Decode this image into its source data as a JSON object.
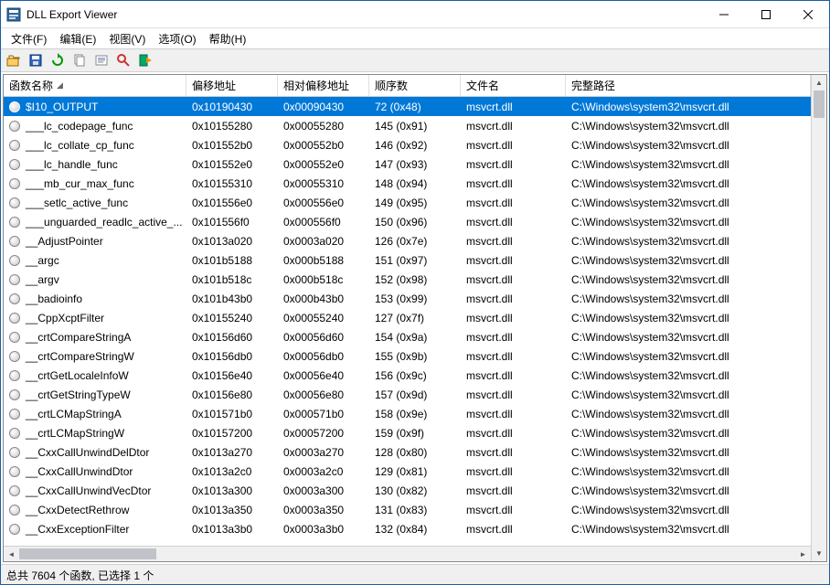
{
  "window": {
    "title": "DLL Export Viewer"
  },
  "menubar": {
    "items": [
      {
        "label": "文件(F)"
      },
      {
        "label": "编辑(E)"
      },
      {
        "label": "视图(V)"
      },
      {
        "label": "选项(O)"
      },
      {
        "label": "帮助(H)"
      }
    ]
  },
  "columns": {
    "name": "函数名称",
    "addr": "偏移地址",
    "rva": "相对偏移地址",
    "ord": "顺序数",
    "file": "文件名",
    "path": "完整路径"
  },
  "selected_index": 0,
  "rows": [
    {
      "name": "$I10_OUTPUT",
      "addr": "0x10190430",
      "rva": "0x00090430",
      "ord": "72 (0x48)",
      "file": "msvcrt.dll",
      "path": "C:\\Windows\\system32\\msvcrt.dll"
    },
    {
      "name": "___lc_codepage_func",
      "addr": "0x10155280",
      "rva": "0x00055280",
      "ord": "145 (0x91)",
      "file": "msvcrt.dll",
      "path": "C:\\Windows\\system32\\msvcrt.dll"
    },
    {
      "name": "___lc_collate_cp_func",
      "addr": "0x101552b0",
      "rva": "0x000552b0",
      "ord": "146 (0x92)",
      "file": "msvcrt.dll",
      "path": "C:\\Windows\\system32\\msvcrt.dll"
    },
    {
      "name": "___lc_handle_func",
      "addr": "0x101552e0",
      "rva": "0x000552e0",
      "ord": "147 (0x93)",
      "file": "msvcrt.dll",
      "path": "C:\\Windows\\system32\\msvcrt.dll"
    },
    {
      "name": "___mb_cur_max_func",
      "addr": "0x10155310",
      "rva": "0x00055310",
      "ord": "148 (0x94)",
      "file": "msvcrt.dll",
      "path": "C:\\Windows\\system32\\msvcrt.dll"
    },
    {
      "name": "___setlc_active_func",
      "addr": "0x101556e0",
      "rva": "0x000556e0",
      "ord": "149 (0x95)",
      "file": "msvcrt.dll",
      "path": "C:\\Windows\\system32\\msvcrt.dll"
    },
    {
      "name": "___unguarded_readlc_active_...",
      "addr": "0x101556f0",
      "rva": "0x000556f0",
      "ord": "150 (0x96)",
      "file": "msvcrt.dll",
      "path": "C:\\Windows\\system32\\msvcrt.dll"
    },
    {
      "name": "__AdjustPointer",
      "addr": "0x1013a020",
      "rva": "0x0003a020",
      "ord": "126 (0x7e)",
      "file": "msvcrt.dll",
      "path": "C:\\Windows\\system32\\msvcrt.dll"
    },
    {
      "name": "__argc",
      "addr": "0x101b5188",
      "rva": "0x000b5188",
      "ord": "151 (0x97)",
      "file": "msvcrt.dll",
      "path": "C:\\Windows\\system32\\msvcrt.dll"
    },
    {
      "name": "__argv",
      "addr": "0x101b518c",
      "rva": "0x000b518c",
      "ord": "152 (0x98)",
      "file": "msvcrt.dll",
      "path": "C:\\Windows\\system32\\msvcrt.dll"
    },
    {
      "name": "__badioinfo",
      "addr": "0x101b43b0",
      "rva": "0x000b43b0",
      "ord": "153 (0x99)",
      "file": "msvcrt.dll",
      "path": "C:\\Windows\\system32\\msvcrt.dll"
    },
    {
      "name": "__CppXcptFilter",
      "addr": "0x10155240",
      "rva": "0x00055240",
      "ord": "127 (0x7f)",
      "file": "msvcrt.dll",
      "path": "C:\\Windows\\system32\\msvcrt.dll"
    },
    {
      "name": "__crtCompareStringA",
      "addr": "0x10156d60",
      "rva": "0x00056d60",
      "ord": "154 (0x9a)",
      "file": "msvcrt.dll",
      "path": "C:\\Windows\\system32\\msvcrt.dll"
    },
    {
      "name": "__crtCompareStringW",
      "addr": "0x10156db0",
      "rva": "0x00056db0",
      "ord": "155 (0x9b)",
      "file": "msvcrt.dll",
      "path": "C:\\Windows\\system32\\msvcrt.dll"
    },
    {
      "name": "__crtGetLocaleInfoW",
      "addr": "0x10156e40",
      "rva": "0x00056e40",
      "ord": "156 (0x9c)",
      "file": "msvcrt.dll",
      "path": "C:\\Windows\\system32\\msvcrt.dll"
    },
    {
      "name": "__crtGetStringTypeW",
      "addr": "0x10156e80",
      "rva": "0x00056e80",
      "ord": "157 (0x9d)",
      "file": "msvcrt.dll",
      "path": "C:\\Windows\\system32\\msvcrt.dll"
    },
    {
      "name": "__crtLCMapStringA",
      "addr": "0x101571b0",
      "rva": "0x000571b0",
      "ord": "158 (0x9e)",
      "file": "msvcrt.dll",
      "path": "C:\\Windows\\system32\\msvcrt.dll"
    },
    {
      "name": "__crtLCMapStringW",
      "addr": "0x10157200",
      "rva": "0x00057200",
      "ord": "159 (0x9f)",
      "file": "msvcrt.dll",
      "path": "C:\\Windows\\system32\\msvcrt.dll"
    },
    {
      "name": "__CxxCallUnwindDelDtor",
      "addr": "0x1013a270",
      "rva": "0x0003a270",
      "ord": "128 (0x80)",
      "file": "msvcrt.dll",
      "path": "C:\\Windows\\system32\\msvcrt.dll"
    },
    {
      "name": "__CxxCallUnwindDtor",
      "addr": "0x1013a2c0",
      "rva": "0x0003a2c0",
      "ord": "129 (0x81)",
      "file": "msvcrt.dll",
      "path": "C:\\Windows\\system32\\msvcrt.dll"
    },
    {
      "name": "__CxxCallUnwindVecDtor",
      "addr": "0x1013a300",
      "rva": "0x0003a300",
      "ord": "130 (0x82)",
      "file": "msvcrt.dll",
      "path": "C:\\Windows\\system32\\msvcrt.dll"
    },
    {
      "name": "__CxxDetectRethrow",
      "addr": "0x1013a350",
      "rva": "0x0003a350",
      "ord": "131 (0x83)",
      "file": "msvcrt.dll",
      "path": "C:\\Windows\\system32\\msvcrt.dll"
    },
    {
      "name": "__CxxExceptionFilter",
      "addr": "0x1013a3b0",
      "rva": "0x0003a3b0",
      "ord": "132 (0x84)",
      "file": "msvcrt.dll",
      "path": "C:\\Windows\\system32\\msvcrt.dll"
    }
  ],
  "statusbar": {
    "text": "总共 7604 个函数, 已选择 1 个"
  }
}
